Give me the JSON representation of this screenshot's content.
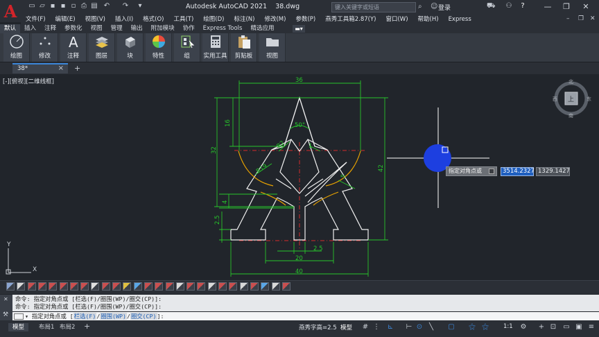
{
  "app": {
    "title": "Autodesk AutoCAD 2021",
    "file": "38.dwg",
    "search_placeholder": "键入关键字或短语",
    "login": "登录",
    "logo_letter": "A"
  },
  "menus": [
    "文件(F)",
    "编辑(E)",
    "视图(V)",
    "插入(I)",
    "格式(O)",
    "工具(T)",
    "绘图(D)",
    "标注(N)",
    "修改(M)",
    "参数(P)",
    "燕秀工具箱2.87(Y)",
    "窗口(W)",
    "帮助(H)",
    "Express"
  ],
  "ribbon_tabs": [
    "默认",
    "插入",
    "注释",
    "参数化",
    "视图",
    "管理",
    "输出",
    "附加模块",
    "协作",
    "Express Tools",
    "精选应用"
  ],
  "ribbon_buttons": [
    "绘图",
    "修改",
    "注释",
    "图层",
    "块",
    "特性",
    "组",
    "实用工具",
    "剪贴板",
    "视图"
  ],
  "file_tab": "38*",
  "view_label": "[-][俯视][二维线框]",
  "viewcube": {
    "north": "北",
    "south": "南",
    "east": "东",
    "west": "西",
    "face": "上"
  },
  "ucs": {
    "x": "X",
    "y": "Y"
  },
  "dimensions": {
    "d36": "36",
    "d16": "16",
    "d32": "32",
    "d42": "42",
    "d50": "50°",
    "dR2": "R2",
    "dR19": "R19",
    "d1": "1",
    "d4": "4",
    "d5": "5",
    "d25": "2.5",
    "d25b": "2.5",
    "d20": "20",
    "d40": "40"
  },
  "prompt": {
    "label": "指定对角点或",
    "x": "3514.2327",
    "y": "1329.1427"
  },
  "command": {
    "history": [
      "命令: 指定对角点或 [栏选(F)/圈围(WP)/圈交(CP)]:",
      "命令: 指定对角点或 [栏选(F)/圈围(WP)/圈交(CP)]:"
    ],
    "current_prefix": "▾ 指定对角点或 [",
    "opt1": "栏选(F)",
    "opt2": "圈围(WP)",
    "opt3": "圈交(CP)",
    "suffix": "]:"
  },
  "layouts": [
    "模型",
    "布局1",
    "布局2"
  ],
  "status": {
    "text_height": "燕秀字高=2.5",
    "model": "模型",
    "scale": "1:1"
  },
  "colors": {
    "accent": "#3b86d8",
    "dimension": "#27c52b",
    "geometry": "#f0f0f0",
    "arc": "#e8a200",
    "centerline": "#d42b2b",
    "cursor_blue": "#1d3fe0"
  }
}
